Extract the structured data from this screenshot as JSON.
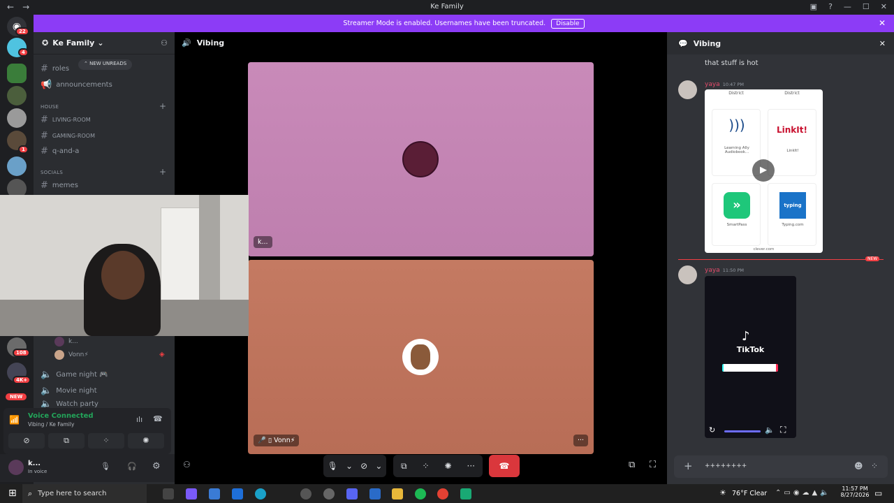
{
  "window": {
    "title": "Ke Family"
  },
  "banner": {
    "text": "Streamer Mode is enabled. Usernames have been truncated.",
    "action": "Disable"
  },
  "servers": {
    "home_badge": "22",
    "badges": [
      "4",
      "1",
      "108",
      "4K+"
    ],
    "new_label": "NEW"
  },
  "guild": {
    "name": "Ke Family"
  },
  "new_unreads": "NEW UNREADS",
  "channels": {
    "top": [
      {
        "name": "roles"
      },
      {
        "name": "announcements"
      }
    ],
    "house_category": "HOUSE",
    "house": [
      {
        "name": "LIVING-ROOM"
      },
      {
        "name": "GAMING-ROOM"
      },
      {
        "name": "q-and-a"
      }
    ],
    "socials_category": "SOCIALS",
    "socials": [
      {
        "name": "memes"
      }
    ],
    "voice_users": [
      {
        "name": "k..."
      },
      {
        "name": "Vonn⚡"
      }
    ],
    "voice_channels": [
      {
        "name": "Game night 🎮"
      },
      {
        "name": "Movie night"
      },
      {
        "name": "Watch party"
      }
    ]
  },
  "voice": {
    "status": "Voice Connected",
    "location": "Vibing / Ke Family"
  },
  "user": {
    "name": "k...",
    "status": "In voice"
  },
  "stage": {
    "title": "Vibing",
    "tile1": {
      "label": "k...",
      "color": "#c481b4"
    },
    "tile2": {
      "label": "Vonn⚡",
      "color": "#c0745c"
    }
  },
  "chat": {
    "title": "Vibing",
    "prev_text": "that stuff is hot",
    "messages": [
      {
        "author": "yaya",
        "time": "10:47 PM"
      },
      {
        "author": "yaya",
        "time": "11:50 PM"
      }
    ],
    "new_divider": "NEW",
    "apps": [
      {
        "name": "Learning Ally Audiobook...",
        "tag": "District"
      },
      {
        "name": "LinkIt!",
        "tag": "District"
      },
      {
        "name": "SmartPass",
        "tag": "District"
      },
      {
        "name": "Typing.com",
        "tag": "District"
      }
    ],
    "clever_url": "clever.com",
    "tiktok": "TikTok",
    "composer_value": "++++++++"
  },
  "taskbar": {
    "search_placeholder": "Type here to search",
    "weather": "76°F  Clear",
    "time": "11:57 PM",
    "date": "8/27/2026"
  },
  "colors": {
    "accent": "#8c3cf6",
    "hangup": "#da373c",
    "voice_green": "#23a55a"
  }
}
